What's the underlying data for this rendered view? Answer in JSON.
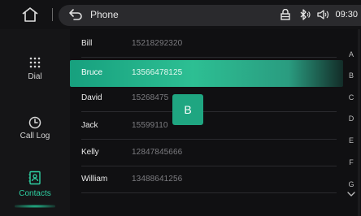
{
  "status_bar": {
    "title": "Phone",
    "time": "09:30",
    "icons": [
      "home-icon",
      "back-icon",
      "lock-icon",
      "bluetooth-icon",
      "volume-icon"
    ]
  },
  "sidebar": {
    "items": [
      {
        "label": "Dial",
        "icon": "dialpad-icon",
        "active": false
      },
      {
        "label": "Call Log",
        "icon": "clock-icon",
        "active": false
      },
      {
        "label": "Contacts",
        "icon": "contacts-icon",
        "active": true
      }
    ]
  },
  "contacts": [
    {
      "name": "Bill",
      "number": "15218292320",
      "selected": false
    },
    {
      "name": "Bruce",
      "number": "13566478125",
      "selected": true
    },
    {
      "name": "David",
      "number": "15268475",
      "selected": false
    },
    {
      "name": "Jack",
      "number": "15599110",
      "selected": false
    },
    {
      "name": "Kelly",
      "number": "12847845666",
      "selected": false
    },
    {
      "name": "William",
      "number": "13488641256",
      "selected": false
    }
  ],
  "letter_popup": "B",
  "alphabet_index": [
    "A",
    "B",
    "C",
    "D",
    "E",
    "F",
    "G"
  ],
  "colors": {
    "accent": "#2dbf93",
    "background": "#101012"
  }
}
